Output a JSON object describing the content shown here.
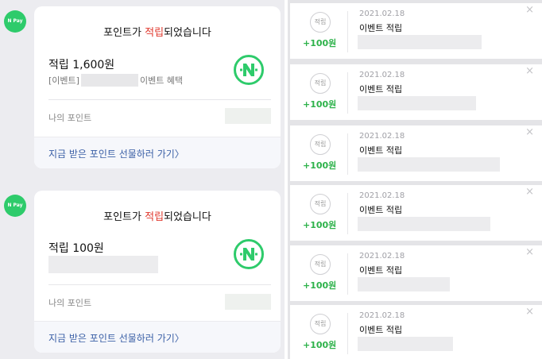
{
  "chat": {
    "messages": [
      {
        "avatar_label": "N Pay",
        "title_prefix": "포인트가 ",
        "title_highlight": "적립",
        "title_suffix": "되었습니다",
        "amount": "적립 1,600원",
        "event_prefix": "[이벤트]",
        "event_suffix": "이벤트 혜택",
        "my_points_label": "나의 포인트",
        "gift_link": "지금 받은 포인트 선물하러 가기〉"
      },
      {
        "avatar_label": "N Pay",
        "title_prefix": "포인트가 ",
        "title_highlight": "적립",
        "title_suffix": "되었습니다",
        "amount": "적립 100원",
        "my_points_label": "나의 포인트",
        "gift_link": "지금 받은 포인트 선물하러 가기〉"
      }
    ]
  },
  "points_list": {
    "items": [
      {
        "stamp": "적립",
        "amount": "+100원",
        "date": "2021.02.18",
        "title": "이벤트 적립",
        "close": "×"
      },
      {
        "stamp": "적립",
        "amount": "+100원",
        "date": "2021.02.18",
        "title": "이벤트 적립",
        "close": "×"
      },
      {
        "stamp": "적립",
        "amount": "+100원",
        "date": "2021.02.18",
        "title": "이벤트 적립",
        "close": "×"
      },
      {
        "stamp": "적립",
        "amount": "+100원",
        "date": "2021.02.18",
        "title": "이벤트 적립",
        "close": "×"
      },
      {
        "stamp": "적립",
        "amount": "+100원",
        "date": "2021.02.18",
        "title": "이벤트 적립",
        "close": "×"
      },
      {
        "stamp": "적립",
        "amount": "+100원",
        "date": "2021.02.18",
        "title": "이벤트 적립",
        "close": "×"
      }
    ]
  },
  "colors": {
    "naver_green": "#2ecb6b",
    "highlight_red": "#e0392e",
    "plus_green": "#2db24a",
    "link_blue": "#3a5fa6"
  },
  "icons": {
    "avatar": "naver-pay-icon",
    "badge": "naver-n-icon",
    "close": "close-icon"
  }
}
